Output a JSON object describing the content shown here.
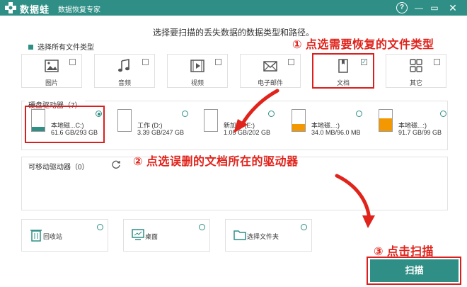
{
  "titlebar": {
    "app_name": "数据蛙",
    "subtitle": "数据恢复专家",
    "help_label": "?",
    "minimize_label": "—",
    "maximize_label": "▭",
    "close_label": "✕"
  },
  "prompt": "选择要扫描的丢失数据的数据类型和路径。",
  "select_all_label": "选择所有文件类型",
  "file_types": [
    {
      "label": "图片",
      "icon": "picture-icon",
      "checked": false
    },
    {
      "label": "音频",
      "icon": "audio-icon",
      "checked": false
    },
    {
      "label": "视频",
      "icon": "video-icon",
      "checked": false
    },
    {
      "label": "电子邮件",
      "icon": "email-icon",
      "checked": false
    },
    {
      "label": "文档",
      "icon": "document-icon",
      "checked": true
    },
    {
      "label": "其它",
      "icon": "other-icon",
      "checked": false
    }
  ],
  "hard_drives": {
    "title": "硬盘驱动器（7）",
    "drives": [
      {
        "name": "本地磁...C:)",
        "size": "61.6 GB/293 GB",
        "selected": true,
        "fill": 0.21,
        "color": "#2f8f86"
      },
      {
        "name": "工作 (D:)",
        "size": "3.39 GB/247 GB",
        "selected": false,
        "fill": 0.0,
        "color": "#2f8f86"
      },
      {
        "name": "新加卷 (E:)",
        "size": "1.05 GB/202 GB",
        "selected": false,
        "fill": 0.0,
        "color": "#2f8f86"
      },
      {
        "name": "本地磁...:)",
        "size": "34.0 MB/96.0 MB",
        "selected": false,
        "fill": 0.35,
        "color": "#f39800"
      },
      {
        "name": "本地磁...:)",
        "size": "91.7 GB/99 GB",
        "selected": false,
        "fill": 0.6,
        "color": "#f39800"
      }
    ]
  },
  "removable": {
    "title": "可移动驱动器（0）"
  },
  "locations": [
    {
      "label": "回收站",
      "icon": "recycle-bin-icon"
    },
    {
      "label": "桌面",
      "icon": "desktop-icon"
    },
    {
      "label": "选择文件夹",
      "icon": "folder-icon"
    }
  ],
  "scan_button": "扫描",
  "annotations": {
    "step1": "① 点选需要恢复的文件类型",
    "step2": "② 点选误删的文档所在的驱动器",
    "step3": "③ 点击扫描"
  },
  "colors": {
    "accent": "#2f8f86",
    "annotation": "#e0231b",
    "warning": "#f39800"
  }
}
